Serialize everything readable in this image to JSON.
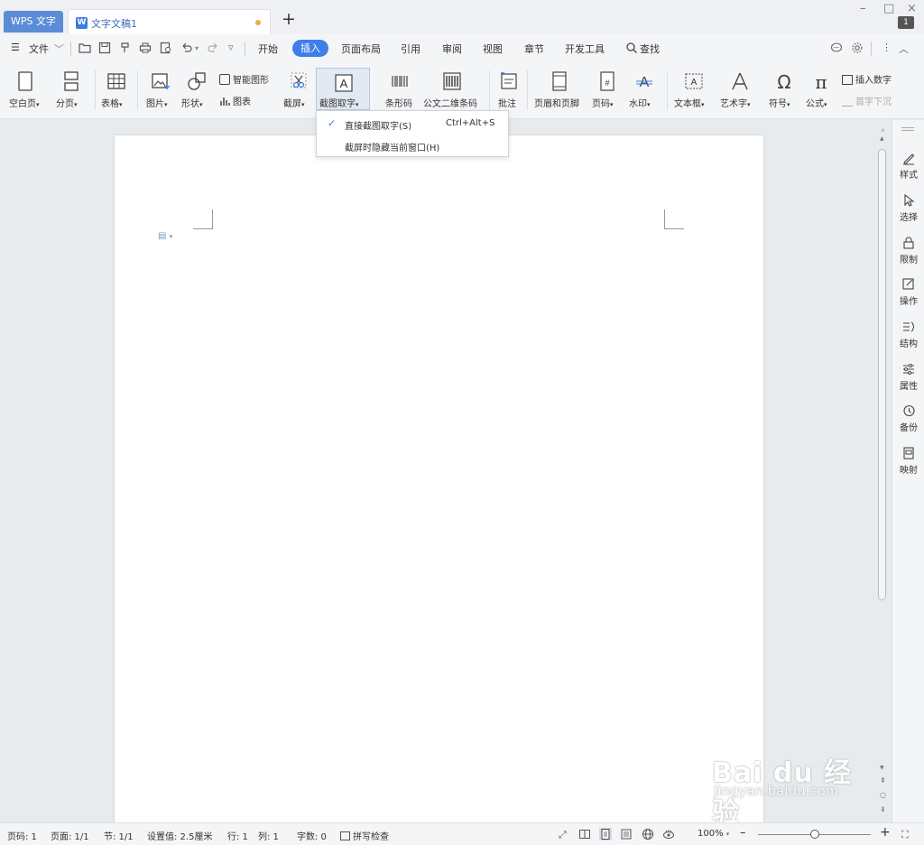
{
  "titlebar": {
    "app_tab": "WPS 文字",
    "doc_tab": "文字文稿1",
    "doc_icon": "W",
    "new_tab": "+",
    "minimize": "–",
    "maximize": "□",
    "close": "×",
    "account_badge": "1"
  },
  "menubar": {
    "file": "文件",
    "tabs": [
      "开始",
      "插入",
      "页面布局",
      "引用",
      "审阅",
      "视图",
      "章节",
      "开发工具"
    ],
    "active_tab": "插入",
    "search": "查找"
  },
  "ribbon": {
    "blank_page": "空白页",
    "page_break": "分页",
    "table": "表格",
    "picture": "图片",
    "shape": "形状",
    "smart_graphic": "智能图形",
    "chart": "图表",
    "screenshot": "截屏",
    "ocr": "截图取字",
    "barcode": "条形码",
    "qrcode": "公文二维条码",
    "comment": "批注",
    "header_footer": "页眉和页脚",
    "page_number": "页码",
    "watermark": "水印",
    "textbox": "文本框",
    "wordart": "艺术字",
    "symbol": "符号",
    "formula": "公式",
    "insert_number": "插入数字",
    "drop_cap": "首字下沉",
    "dropdown_arrow": "▾"
  },
  "dropdown": {
    "item1": "直接截图取字(S)",
    "item1_shortcut": "Ctrl+Alt+S",
    "item1_check": "✓",
    "item2": "截屏时隐藏当前窗口(H)"
  },
  "sidepanel": [
    "样式",
    "选择",
    "限制",
    "操作",
    "结构",
    "属性",
    "备份",
    "映射"
  ],
  "statusbar": {
    "page_no": "页码: 1",
    "pages": "页面: 1/1",
    "section": "节: 1/1",
    "setting": "设置值: 2.5厘米",
    "row": "行: 1",
    "col": "列: 1",
    "words": "字数: 0",
    "spellcheck": "拼写检查",
    "zoom": "100%",
    "zoom_out": "–",
    "zoom_in": "+"
  },
  "watermark": {
    "brand": "Bai du 经验",
    "site": "jingyan.baidu.com"
  },
  "colors": {
    "accent": "#3e7ee8",
    "app_tab": "#5b8dd6",
    "modified_dot": "#f0a848"
  }
}
